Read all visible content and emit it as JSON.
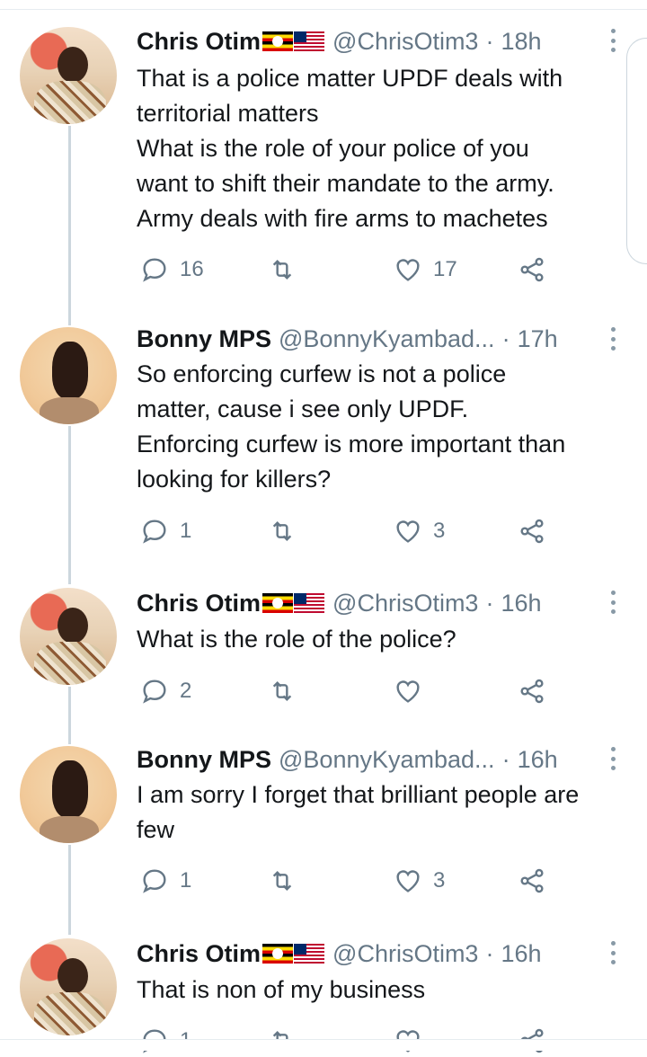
{
  "tweets": [
    {
      "name": "Chris Otim",
      "handle": "@ChrisOtim3",
      "dot": "·",
      "time": "18h",
      "avatar": "chris",
      "lines": [
        "That is a police matter UPDF deals with",
        "territorial matters",
        "What is the role of your police of you",
        "want to shift their mandate to the army.",
        "Army deals with fire arms to machetes"
      ],
      "replies": "16",
      "retweets": "",
      "likes": "17"
    },
    {
      "name": "Bonny MPS",
      "handle": "@BonnyKyambad...",
      "dot": "·",
      "time": "17h",
      "avatar": "bonny",
      "lines": [
        "So enforcing curfew is not a police",
        "matter, cause i see only UPDF.",
        "Enforcing curfew is more important than",
        "looking for killers?"
      ],
      "replies": "1",
      "retweets": "",
      "likes": "3"
    },
    {
      "name": "Chris Otim",
      "handle": "@ChrisOtim3",
      "dot": "·",
      "time": "16h",
      "avatar": "chris",
      "lines": [
        "What is the role of the police?"
      ],
      "replies": "2",
      "retweets": "",
      "likes": ""
    },
    {
      "name": "Bonny MPS",
      "handle": "@BonnyKyambad...",
      "dot": "·",
      "time": "16h",
      "avatar": "bonny",
      "lines": [
        "I am sorry I forget that brilliant people are",
        "few"
      ],
      "replies": "1",
      "retweets": "",
      "likes": "3"
    },
    {
      "name": "Chris Otim",
      "handle": "@ChrisOtim3",
      "dot": "·",
      "time": "16h",
      "avatar": "chris",
      "lines": [
        "That is non of my business"
      ],
      "replies": "1",
      "retweets": "",
      "likes": ""
    }
  ],
  "flags": [
    "uganda-flag",
    "liberia-flag"
  ],
  "colors": {
    "text": "#14171a",
    "secondary": "#657786",
    "thread_line": "#ccd6dd"
  }
}
